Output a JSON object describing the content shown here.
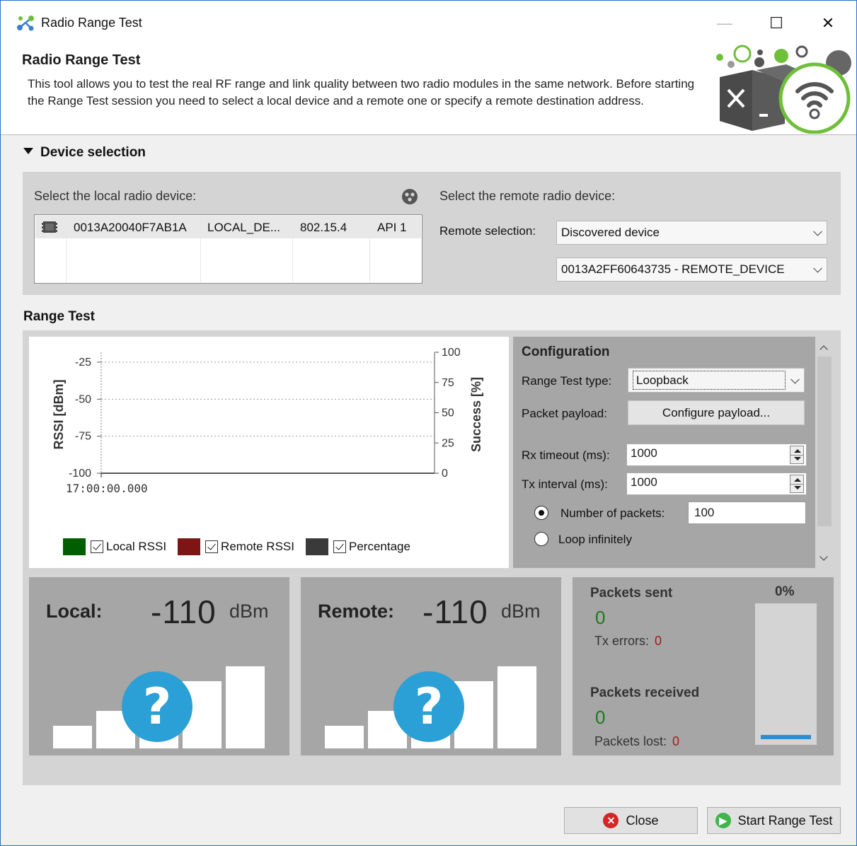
{
  "window": {
    "title": "Radio Range Test",
    "controls": {
      "minimize": "—",
      "maximize": "☐",
      "close": "✕"
    }
  },
  "header": {
    "title": "Radio Range Test",
    "description": "This tool allows you to test the real RF range and link quality between two radio modules in the same network. Before starting the Range Test session you need to select a local device and a remote one or specify a remote destination address."
  },
  "device_selection": {
    "title": "Device selection",
    "local_label": "Select the local radio device:",
    "local_device": {
      "mac": "0013A20040F7AB1A",
      "name": "LOCAL_DE...",
      "protocol": "802.15.4",
      "mode": "API 1"
    },
    "remote_label": "Select the remote radio device:",
    "remote_selection_label": "Remote selection:",
    "remote_selection_value": "Discovered device",
    "remote_device_value": "0013A2FF60643735 - REMOTE_DEVICE"
  },
  "range_test": {
    "title": "Range Test",
    "chart_data": {
      "type": "line",
      "xlabel": "",
      "ylabel": "RSSI [dBm]",
      "y2label": "Success [%]",
      "ylim": [
        -100,
        -25
      ],
      "y2lim": [
        0,
        100
      ],
      "y_ticks": [
        "-25",
        "-50",
        "-75",
        "-100"
      ],
      "y2_ticks": [
        "100",
        "75",
        "50",
        "25",
        "0"
      ],
      "x_ticks": [
        "17:00:00.000"
      ],
      "grid": true,
      "series": [
        {
          "name": "Local RSSI",
          "values": [],
          "color": "#005e00",
          "checked": true
        },
        {
          "name": "Remote RSSI",
          "values": [],
          "color": "#7e1515",
          "checked": true
        },
        {
          "name": "Percentage",
          "values": [],
          "color": "#3a3a3a",
          "checked": true
        }
      ]
    },
    "configuration": {
      "title": "Configuration",
      "type_label": "Range Test type:",
      "type_value": "Loopback",
      "payload_label": "Packet payload:",
      "payload_button": "Configure payload...",
      "rx_timeout_label": "Rx timeout (ms):",
      "rx_timeout_value": "1000",
      "tx_interval_label": "Tx interval (ms):",
      "tx_interval_value": "1000",
      "num_packets_label": "Number of packets:",
      "num_packets_value": "100",
      "loop_label": "Loop infinitely"
    },
    "local_signal": {
      "label": "Local:",
      "value": "-110",
      "unit": "dBm",
      "badge": "?"
    },
    "remote_signal": {
      "label": "Remote:",
      "value": "-110",
      "unit": "dBm",
      "badge": "?"
    },
    "packets": {
      "sent_label": "Packets sent",
      "sent_value": "0",
      "tx_errors_label": "Tx errors:",
      "tx_errors_value": "0",
      "received_label": "Packets received",
      "received_value": "0",
      "lost_label": "Packets lost:",
      "lost_value": "0",
      "percent_label": "0%",
      "percent": 0
    }
  },
  "footer": {
    "close_label": "Close",
    "start_label": "Start Range Test"
  }
}
